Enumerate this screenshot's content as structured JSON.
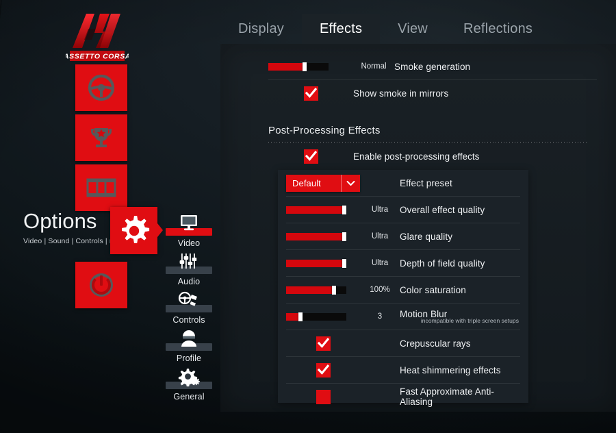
{
  "app": {
    "logo_text": "ASSETTO CORSA",
    "logo_name": "assetto-corsa-logo"
  },
  "tiles": [
    {
      "name": "steering-wheel-icon",
      "label": "Drive"
    },
    {
      "name": "trophy-icon",
      "label": "Career"
    },
    {
      "name": "film-strip-icon",
      "label": "Replay"
    },
    {
      "name": "power-icon",
      "label": "Quit"
    }
  ],
  "options": {
    "title": "Options",
    "subtitle": "Video | Sound | Controls | more",
    "gear_icon": "gear-icon"
  },
  "nav": {
    "items": [
      {
        "label": "Video",
        "icon": "monitor-icon",
        "active": true
      },
      {
        "label": "Audio",
        "icon": "sliders-icon",
        "active": false
      },
      {
        "label": "Controls",
        "icon": "wheel-pedals-icon",
        "active": false
      },
      {
        "label": "Profile",
        "icon": "driver-icon",
        "active": false
      },
      {
        "label": "General",
        "icon": "gears-icon",
        "active": false
      }
    ]
  },
  "tabs": [
    {
      "label": "Display",
      "active": false
    },
    {
      "label": "Effects",
      "active": true
    },
    {
      "label": "View",
      "active": false
    },
    {
      "label": "Reflections",
      "active": false
    }
  ],
  "smoke": {
    "generation": {
      "label": "Smoke generation",
      "value": "Normal",
      "fill_percent": 60
    },
    "mirrors": {
      "label": "Show smoke in mirrors",
      "checked": true
    }
  },
  "post_processing": {
    "heading": "Post-Processing Effects",
    "enable": {
      "label": "Enable post-processing effects",
      "checked": true
    },
    "rows": [
      {
        "type": "dropdown",
        "label": "Effect preset",
        "value": "Default"
      },
      {
        "type": "slider",
        "label": "Overall effect quality",
        "value": "Ultra",
        "fill_percent": 97
      },
      {
        "type": "slider",
        "label": "Glare quality",
        "value": "Ultra",
        "fill_percent": 97
      },
      {
        "type": "slider",
        "label": "Depth of field quality",
        "value": "Ultra",
        "fill_percent": 97
      },
      {
        "type": "slider",
        "label": "Color saturation",
        "value": "100%",
        "fill_percent": 79
      },
      {
        "type": "slider",
        "label": "Motion Blur",
        "sublabel": "incompatible with triple screen setups",
        "value": "3",
        "fill_percent": 24
      },
      {
        "type": "checkbox",
        "label": "Crepuscular rays",
        "checked": true
      },
      {
        "type": "checkbox",
        "label": "Heat shimmering effects",
        "checked": true
      },
      {
        "type": "checkbox",
        "label": "Fast Approximate Anti-Aliasing",
        "checked": false
      }
    ]
  },
  "colors": {
    "accent_red": "#e00d12",
    "slider_red": "#d5070d",
    "panel_bg": "#161d22",
    "subpanel_bg": "#1b2228",
    "page_bg": "#11181d",
    "nav_bar_inactive": "#38414a",
    "text_primary": "#eef0f2",
    "text_muted": "#9aa3aa"
  }
}
